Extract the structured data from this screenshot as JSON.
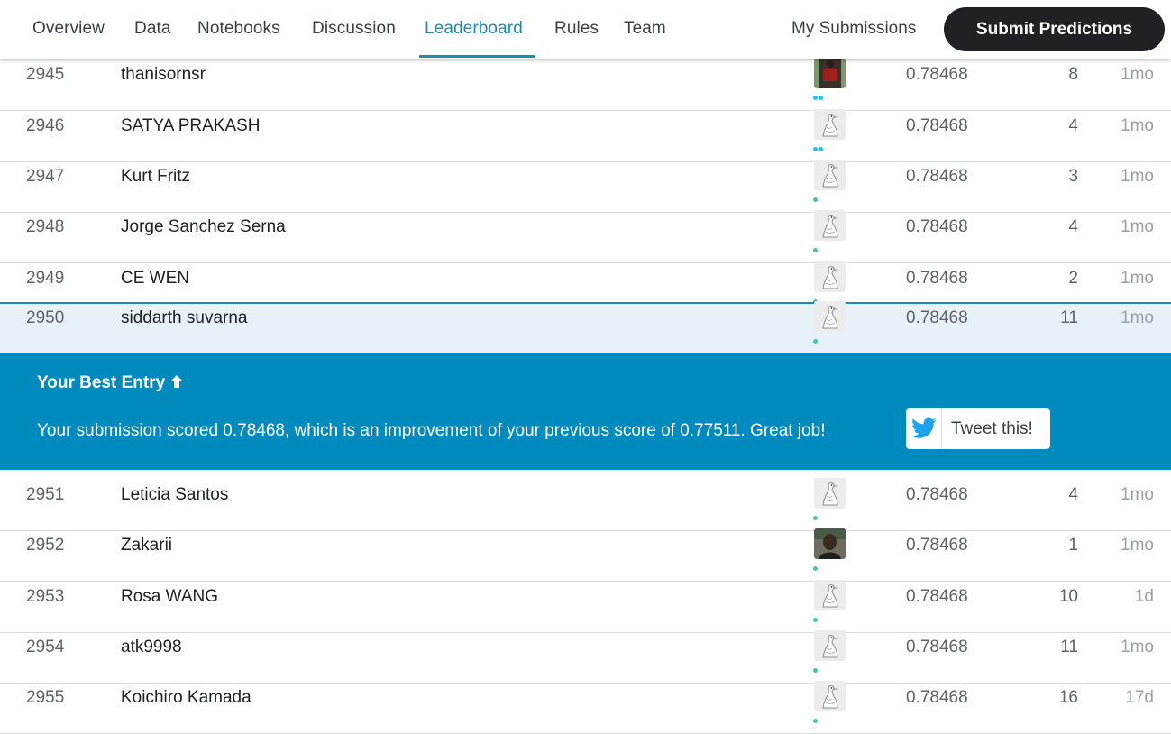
{
  "nav": {
    "tabs": [
      {
        "label": "Overview"
      },
      {
        "label": "Data"
      },
      {
        "label": "Notebooks"
      },
      {
        "label": "Discussion"
      },
      {
        "label": "Leaderboard"
      },
      {
        "label": "Rules"
      },
      {
        "label": "Team"
      }
    ],
    "active_tab": "Leaderboard",
    "my_submissions": "My Submissions",
    "submit_button": "Submit Predictions"
  },
  "leaderboard": {
    "rows_before": [
      {
        "rank": "2945",
        "name": "thanisornsr",
        "avatar": "photo-icon",
        "score": "0.78468",
        "entries": "8",
        "last": "1mo"
      },
      {
        "rank": "2946",
        "name": "SATYA PRAKASH",
        "avatar": "default-goose-icon",
        "score": "0.78468",
        "entries": "4",
        "last": "1mo"
      },
      {
        "rank": "2947",
        "name": "Kurt Fritz",
        "avatar": "default-goose-icon",
        "score": "0.78468",
        "entries": "3",
        "last": "1mo"
      },
      {
        "rank": "2948",
        "name": "Jorge Sanchez Serna",
        "avatar": "default-goose-icon",
        "score": "0.78468",
        "entries": "4",
        "last": "1mo"
      },
      {
        "rank": "2949",
        "name": "CE WEN",
        "avatar": "default-goose-icon",
        "score": "0.78468",
        "entries": "2",
        "last": "1mo"
      }
    ],
    "user_row": {
      "rank": "2950",
      "name": "siddarth suvarna",
      "avatar": "default-goose-icon",
      "score": "0.78468",
      "entries": "11",
      "last": "1mo"
    },
    "rows_after": [
      {
        "rank": "2951",
        "name": "Leticia Santos",
        "avatar": "default-goose-icon",
        "score": "0.78468",
        "entries": "4",
        "last": "1mo"
      },
      {
        "rank": "2952",
        "name": "Zakarii",
        "avatar": "photo-icon",
        "score": "0.78468",
        "entries": "1",
        "last": "1mo"
      },
      {
        "rank": "2953",
        "name": "Rosa WANG",
        "avatar": "default-goose-icon",
        "score": "0.78468",
        "entries": "10",
        "last": "1d"
      },
      {
        "rank": "2954",
        "name": "atk9998",
        "avatar": "default-goose-icon",
        "score": "0.78468",
        "entries": "11",
        "last": "1mo"
      },
      {
        "rank": "2955",
        "name": "Koichiro Kamada",
        "avatar": "default-goose-icon",
        "score": "0.78468",
        "entries": "16",
        "last": "17d"
      }
    ]
  },
  "banner": {
    "title": "Your Best Entry",
    "message": "Your submission scored 0.78468, which is an improvement of your previous score of 0.77511. Great job!",
    "tweet_label": "Tweet this!"
  },
  "colors": {
    "accent": "#1a8cb3",
    "banner_bg": "#008abd",
    "submit_bg": "#202124",
    "highlight_row": "#e6f2f7",
    "tier_blue": "#20beff",
    "tier_teal": "#3fc7a6"
  }
}
